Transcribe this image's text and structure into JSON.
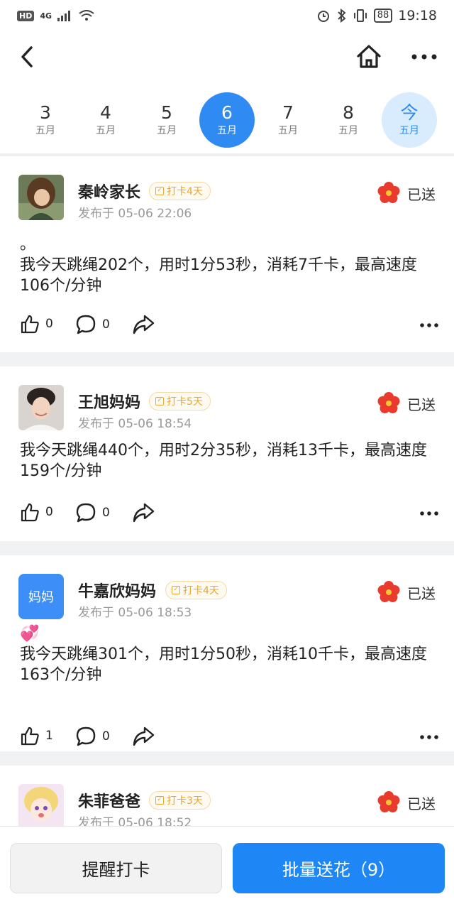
{
  "status_bar": {
    "hd": "HD",
    "network": "4G",
    "battery": "88",
    "time": "19:18"
  },
  "nav": {
    "back_icon": "chevron-left-icon",
    "home_icon": "home-icon",
    "more_icon": "more-horizontal-icon"
  },
  "dates": [
    {
      "num": "3",
      "month": "五月",
      "state": "normal"
    },
    {
      "num": "4",
      "month": "五月",
      "state": "normal"
    },
    {
      "num": "5",
      "month": "五月",
      "state": "normal"
    },
    {
      "num": "6",
      "month": "五月",
      "state": "selected"
    },
    {
      "num": "7",
      "month": "五月",
      "state": "normal"
    },
    {
      "num": "8",
      "month": "五月",
      "state": "normal"
    },
    {
      "num": "今",
      "month": "五月",
      "state": "today"
    }
  ],
  "posts": [
    {
      "name": "秦岭家长",
      "badge": "打卡4天",
      "time": "发布于 05-06 22:06",
      "sent_label": "已送",
      "pre": "。",
      "content": "我今天跳绳202个，用时1分53秒，消耗7千卡，最高速度106个/分钟",
      "likes": "0",
      "comments": "0"
    },
    {
      "name": "王旭妈妈",
      "badge": "打卡5天",
      "time": "发布于 05-06 18:54",
      "sent_label": "已送",
      "pre": "",
      "content": "我今天跳绳440个，用时2分35秒，消耗13千卡，最高速度159个/分钟",
      "likes": "0",
      "comments": "0"
    },
    {
      "name": "牛嘉欣妈妈",
      "avatar_text": "妈妈",
      "badge": "打卡4天",
      "time": "发布于 05-06 18:53",
      "sent_label": "已送",
      "pre": "💞",
      "content": "我今天跳绳301个，用时1分50秒，消耗10千卡，最高速度163个/分钟",
      "likes": "1",
      "comments": "0"
    },
    {
      "name": "朱菲爸爸",
      "badge": "打卡3天",
      "time": "发布于 05-06 18:52",
      "sent_label": "已送"
    }
  ],
  "bottom": {
    "remind_label": "提醒打卡",
    "send_label": "批量送花（9）"
  },
  "colors": {
    "accent": "#2f8bf2",
    "badge": "#e8a636",
    "flower": "#e83b2e"
  }
}
